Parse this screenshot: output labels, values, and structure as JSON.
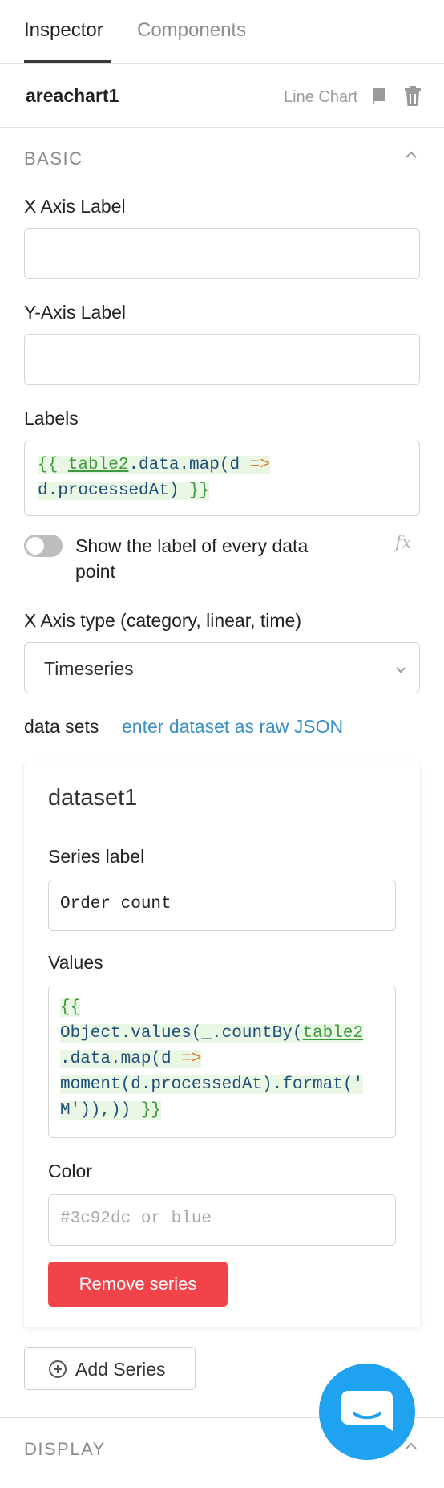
{
  "tabs": {
    "inspector": "Inspector",
    "components": "Components"
  },
  "component": {
    "name": "areachart1",
    "type": "Line Chart"
  },
  "sections": {
    "basic": "BASIC",
    "display": "DISPLAY"
  },
  "fields": {
    "x_axis_label": {
      "label": "X Axis Label",
      "value": ""
    },
    "y_axis_label": {
      "label": "Y-Axis Label",
      "value": ""
    },
    "labels": {
      "label": "Labels",
      "code": {
        "open": "{{ ",
        "ref": "table2",
        "p1": ".data.map(d ",
        "arrow": "=>",
        "line2": "d.processedAt) ",
        "close": "}}"
      }
    },
    "show_all_labels": {
      "label": "Show the label of every data point",
      "enabled": false
    },
    "x_axis_type": {
      "label": "X Axis type (category, linear, time)",
      "value": "Timeseries"
    }
  },
  "datasets": {
    "label": "data sets",
    "raw_json_link": "enter dataset as raw JSON",
    "items": [
      {
        "title": "dataset1",
        "series_label_label": "Series label",
        "series_label_value": "Order count",
        "values_label": "Values",
        "values_code": {
          "l1": "{{",
          "l2a": "Object.values(_.countBy(",
          "l2ref": "table2",
          "l3a": ".data.map(d ",
          "l3arrow": "=>",
          "l4": "moment(d.processedAt).format('",
          "l5a": "M')),)) ",
          "l5b": "}}"
        },
        "color_label": "Color",
        "color_placeholder": "#3c92dc or blue",
        "remove_button": "Remove series"
      }
    ]
  },
  "add_series_button": "Add Series",
  "colors": {
    "accent_link": "#3a8fc4",
    "danger": "#f1434a",
    "chat": "#1fa3f0"
  }
}
